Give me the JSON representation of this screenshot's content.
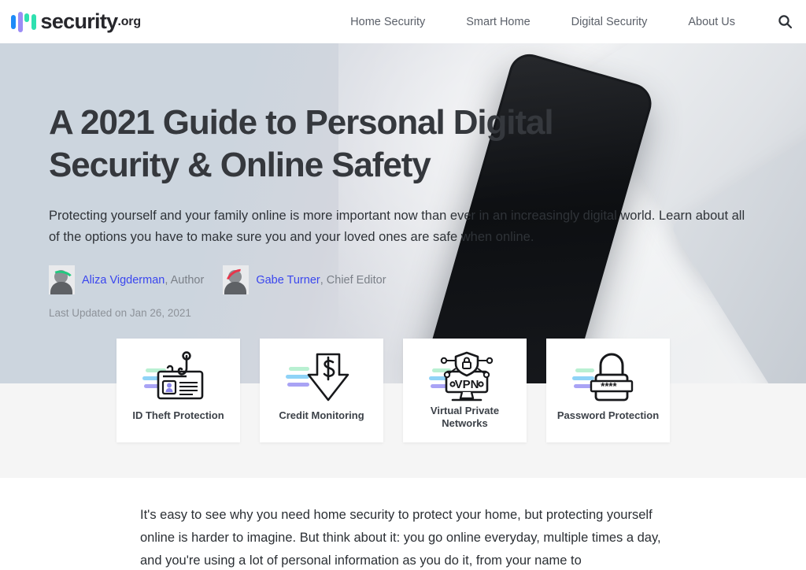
{
  "site": {
    "logo_word": "security",
    "logo_tld": ".org",
    "logo_colors": [
      "#1d8bf8",
      "#9b8cf5",
      "#2fe0b0"
    ]
  },
  "nav": {
    "items": [
      {
        "label": "Home Security"
      },
      {
        "label": "Smart Home"
      },
      {
        "label": "Digital Security"
      },
      {
        "label": "About Us"
      }
    ],
    "search_icon": "search-icon"
  },
  "hero": {
    "title": "A 2021 Guide to Personal Digital Security & Online Safety",
    "subtitle": "Protecting yourself and your family online is more important now than ever in an increasingly digital world. Learn about all of the options you have to make sure you and your loved ones are safe when online.",
    "authors": [
      {
        "name": "Aliza Vigderman",
        "role": ", Author",
        "avatar": "avatar-aliza-vigderman"
      },
      {
        "name": "Gabe Turner",
        "role": ", Chief Editor",
        "avatar": "avatar-gabe-turner"
      }
    ],
    "last_updated": "Last Updated on Jan 26, 2021",
    "link_color": "#3a46ee",
    "background": "desk-photo-with-smartphone-and-laptop"
  },
  "cards": [
    {
      "label": "ID Theft Protection",
      "icon": "id-badge-fishing-hook-icon"
    },
    {
      "label": "Credit Monitoring",
      "icon": "dollar-down-arrow-icon"
    },
    {
      "label": "Virtual Private Networks",
      "icon": "vpn-monitor-shield-icon"
    },
    {
      "label": "Password Protection",
      "icon": "padlock-password-icon"
    }
  ],
  "card_accent_colors": [
    "#b9f0d2",
    "#8fd3f7",
    "#a9a3f5"
  ],
  "article": {
    "paragraph": "It's easy to see why you need home security to protect your home, but protecting yourself online is harder to imagine. But think about it: you go online everyday, multiple times a day, and you're using a lot of personal information as you do it, from your name to"
  }
}
